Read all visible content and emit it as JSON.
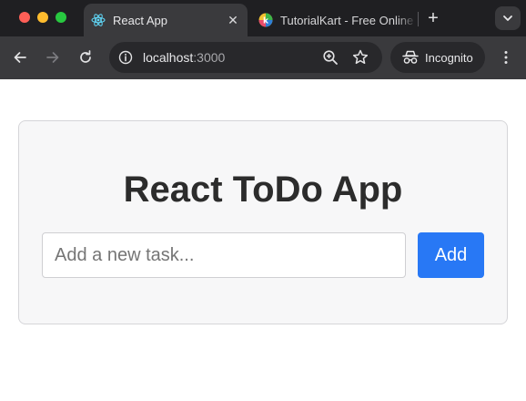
{
  "browser": {
    "tabs": [
      {
        "title": "React App",
        "favicon": "react-icon",
        "active": true
      },
      {
        "title": "TutorialKart - Free Online Tutorials",
        "favicon": "tutorialkart-icon",
        "active": false
      }
    ],
    "address": {
      "host": "localhost",
      "port": ":3000"
    },
    "profile_label": "Incognito"
  },
  "app": {
    "title": "React ToDo App",
    "input_placeholder": "Add a new task...",
    "add_label": "Add"
  },
  "colors": {
    "accent": "#2878f5",
    "chrome_dark": "#1f1f22",
    "toolbar": "#3a3a3d",
    "card_bg": "#f7f7f8"
  }
}
